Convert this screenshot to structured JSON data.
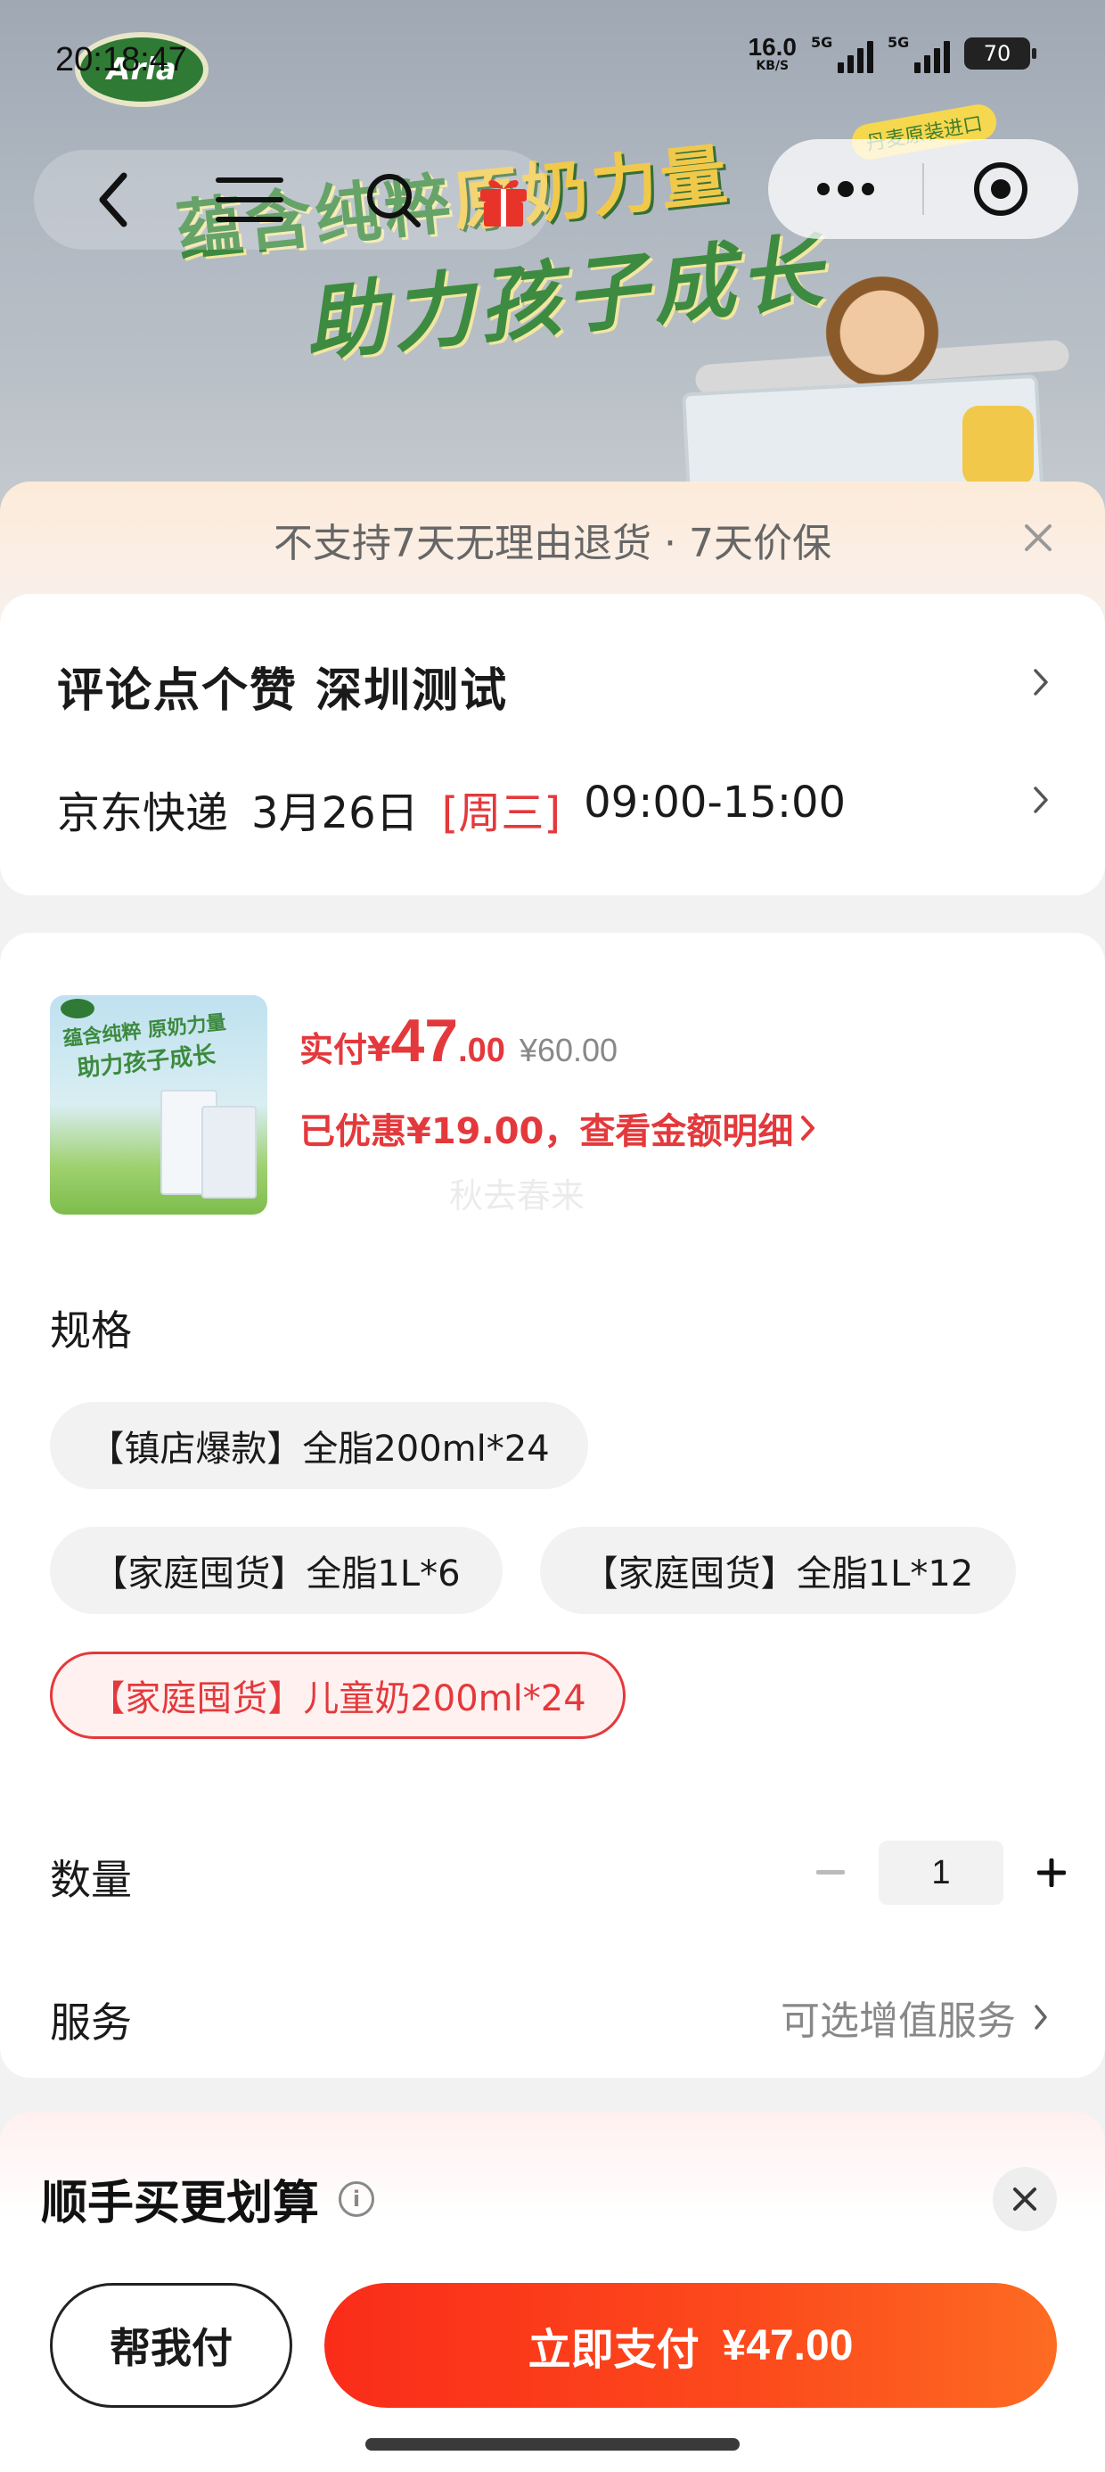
{
  "status_bar": {
    "time": "20:18:47",
    "net_speed_value": "16.0",
    "net_speed_unit": "KB/S",
    "signal_labels": [
      "5G",
      "5G"
    ],
    "battery": "70"
  },
  "hero": {
    "brand": "Arla",
    "line1_part1": "蕴含纯粹",
    "line1_part2": "原奶力量",
    "line2": "助力孩子成长",
    "badge": "丹麦原装进口"
  },
  "notice": {
    "text": "不支持7天无理由退货 · 7天价保"
  },
  "address": {
    "name": "评论点个赞  深圳测试",
    "carrier": "京东快递",
    "date": "3月26日",
    "weekday": "[周三]",
    "time_window": "09:00-15:00"
  },
  "product": {
    "thumb_line1": "蕴含纯粹 原奶力量",
    "thumb_line2": "助力孩子成长",
    "paid_label": "实付¥",
    "paid_int": "47",
    "paid_dec": ".00",
    "original_price": "¥60.00",
    "discount_text": "已优惠¥19.00，查看金额明细",
    "watermark": "秋去春来"
  },
  "specs": {
    "label": "规格",
    "options": [
      "【镇店爆款】全脂200ml*24",
      "【家庭囤货】全脂1L*6",
      "【家庭囤货】全脂1L*12",
      "【家庭囤货】儿童奶200ml*24"
    ],
    "selected_index": 3
  },
  "quantity": {
    "label": "数量",
    "value": "1"
  },
  "service": {
    "label": "服务",
    "hint": "可选增值服务"
  },
  "extra": {
    "title": "顺手买更划算"
  },
  "bottom": {
    "help_pay": "帮我付",
    "pay_label": "立即支付",
    "pay_amount": "¥47.00"
  },
  "colors": {
    "accent_red": "#e4393c",
    "pay_button": "#fa2c19",
    "brand_green": "#3c8a3f"
  },
  "icons": [
    "back-icon",
    "menu-icon",
    "search-icon",
    "gift-icon",
    "more-icon",
    "target-icon",
    "close-icon",
    "chevron-right-icon",
    "info-icon",
    "minus-icon",
    "plus-icon"
  ]
}
